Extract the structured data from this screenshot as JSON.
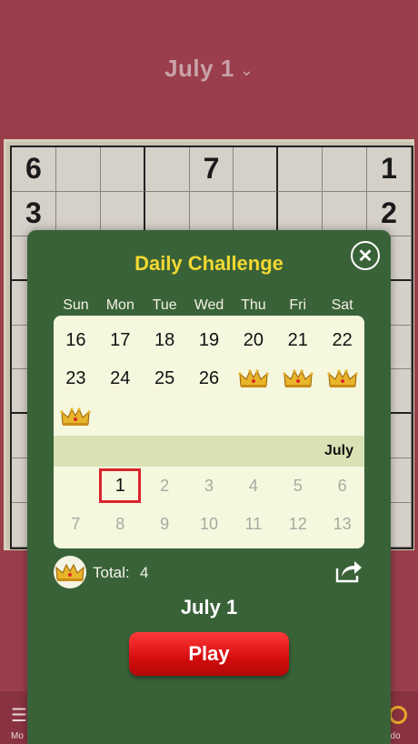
{
  "header": {
    "title": "July 1"
  },
  "board": {
    "row1": [
      "6",
      "",
      "",
      "",
      "7",
      "",
      "",
      "",
      "1"
    ],
    "row2": [
      "3",
      "",
      "",
      "",
      "",
      "",
      "",
      "",
      "2"
    ]
  },
  "modal": {
    "title": "Daily Challenge",
    "weekdays": [
      "Sun",
      "Mon",
      "Tue",
      "Wed",
      "Thu",
      "Fri",
      "Sat"
    ],
    "june_weeks": [
      [
        "16",
        "17",
        "18",
        "19",
        "20",
        "21",
        "22"
      ],
      [
        "23",
        "24",
        "25",
        "26",
        "crown",
        "crown",
        "crown"
      ],
      [
        "crown",
        "",
        "",
        "",
        "",
        "",
        ""
      ]
    ],
    "month_label": "July",
    "july_weeks": [
      [
        "",
        "1",
        "2",
        "3",
        "4",
        "5",
        "6"
      ],
      [
        "7",
        "8",
        "9",
        "10",
        "11",
        "12",
        "13"
      ]
    ],
    "total_label": "Total:",
    "total_value": "4",
    "selected_date": "July 1",
    "play_label": "Play"
  },
  "bottom": {
    "left_label": "Mo",
    "right_label": "ndo"
  },
  "colors": {
    "modal_bg": "#3a6238",
    "title": "#f2d832",
    "play": "#e11a1a",
    "today_outline": "#d8262b",
    "page_bg": "#9a3e4c"
  }
}
